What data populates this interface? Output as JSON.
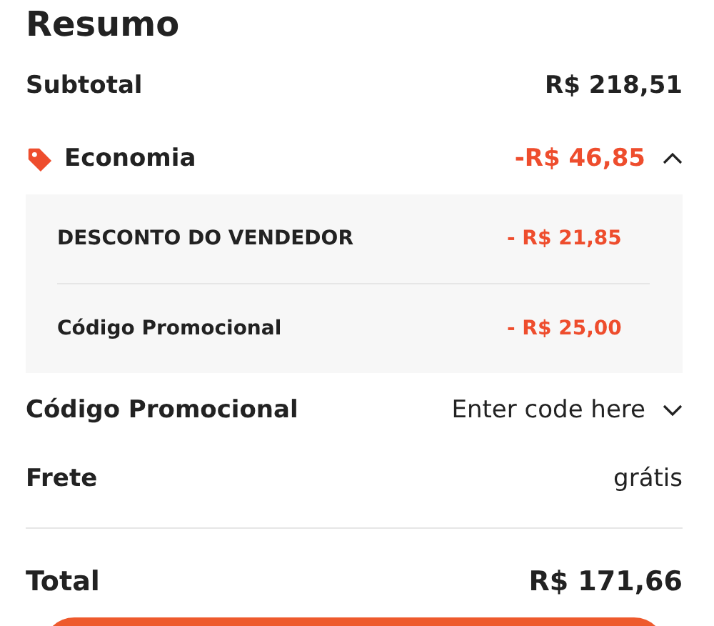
{
  "title": "Resumo",
  "subtotal": {
    "label": "Subtotal",
    "value": "R$ 218,51"
  },
  "savings": {
    "label": "Economia",
    "value": "-R$ 46,85",
    "expanded": true,
    "items": [
      {
        "label": "DESCONTO DO VENDEDOR",
        "value": "- R$ 21,85"
      },
      {
        "label": "Código Promocional",
        "value": "- R$ 25,00"
      }
    ]
  },
  "promo": {
    "label": "Código Promocional",
    "action": "Enter code here",
    "expanded": false
  },
  "shipping": {
    "label": "Frete",
    "value": "grátis"
  },
  "total": {
    "label": "Total",
    "value": "R$ 171,66"
  }
}
